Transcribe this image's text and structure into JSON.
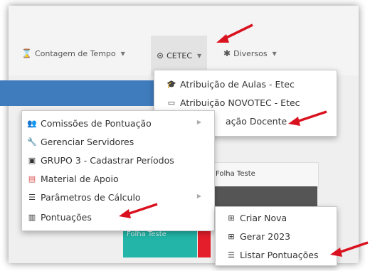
{
  "nav": {
    "contagem": {
      "label": "Contagem de Tempo",
      "icon": "hourglass-icon"
    },
    "cetec": {
      "label": "CETEC",
      "icon": "circle-chevron-icon"
    },
    "diversos": {
      "label": "Diversos",
      "icon": "asterisk-icon"
    }
  },
  "cetec_menu": [
    {
      "label": "Atribuição de Aulas - Etec",
      "icon": "graduation-cap-icon"
    },
    {
      "label": "Atribuição NOVOTEC - Etec",
      "icon": "chalkboard-icon"
    },
    {
      "label": "ação Docente",
      "icon": ""
    }
  ],
  "main_menu": [
    {
      "label": "Comissões de Pontuação",
      "icon": "users-icon",
      "has_submenu": true
    },
    {
      "label": "Gerenciar Servidores",
      "icon": "wrench-icon",
      "has_submenu": false
    },
    {
      "label": "GRUPO 3 - Cadastrar Períodos",
      "icon": "calendar-icon",
      "has_submenu": false
    },
    {
      "label": "Material de Apoio",
      "icon": "pdf-file-icon",
      "has_submenu": false
    },
    {
      "label": "Parâmetros de Cálculo",
      "icon": "list-icon",
      "has_submenu": true
    },
    {
      "label": "Pontuações",
      "icon": "bar-chart-icon",
      "has_submenu": false
    }
  ],
  "pontuacoes_menu": [
    {
      "label": "Criar Nova",
      "icon": "plus-square-icon"
    },
    {
      "label": "Gerar 2023",
      "icon": "plus-square-icon"
    },
    {
      "label": "Listar Pontuações",
      "icon": "list-icon"
    }
  ],
  "background": {
    "card_title": "Folha Teste",
    "tile_text": "Folha Teste"
  },
  "colors": {
    "annotation_arrow": "#d9121f",
    "blue_band": "#3f7cbd",
    "teal_tile": "#22b5a8",
    "red_tile": "#e41e2a",
    "pdf_icon": "#d9534f"
  }
}
